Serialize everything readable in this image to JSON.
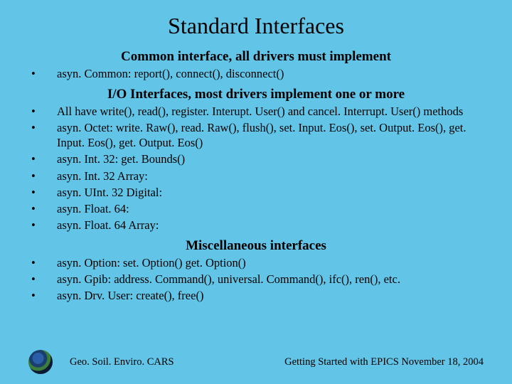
{
  "title": "Standard Interfaces",
  "sections": {
    "s1": {
      "heading": "Common interface, all drivers must implement",
      "b0": "asyn. Common: report(), connect(), disconnect()"
    },
    "s2": {
      "heading": "I/O Interfaces, most drivers implement one or more",
      "b0": "All have write(), read(), register. Interupt. User() and cancel. Interrupt. User() methods",
      "b1": "asyn. Octet: write. Raw(), read. Raw(), flush(), set. Input. Eos(), set. Output. Eos(), get. Input. Eos(), get. Output. Eos()",
      "b2": "asyn. Int. 32: get. Bounds()",
      "b3": "asyn. Int. 32 Array:",
      "b4": "asyn. UInt. 32 Digital:",
      "b5": "asyn. Float. 64:",
      "b6": "asyn. Float. 64 Array:"
    },
    "s3": {
      "heading": "Miscellaneous interfaces",
      "b0": "asyn. Option: set. Option() get. Option()",
      "b1": "asyn. Gpib:  address. Command(), universal. Command(), ifc(), ren(), etc.",
      "b2": "asyn. Drv. User: create(), free()"
    }
  },
  "footer": {
    "left": "Geo. Soil. Enviro. CARS",
    "right": "Getting Started with EPICS   November 18, 2004"
  }
}
